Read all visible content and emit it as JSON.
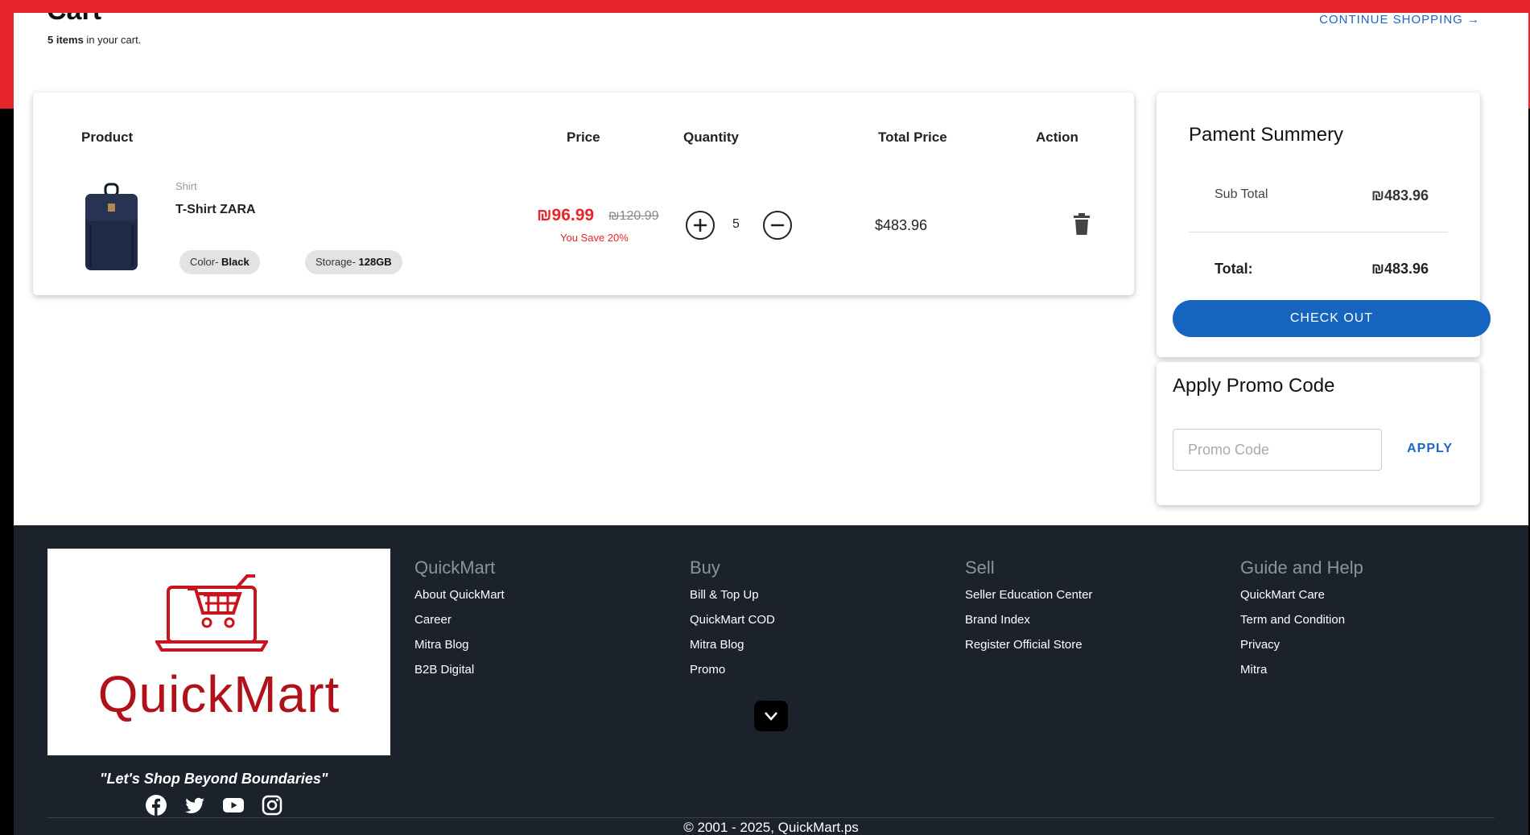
{
  "header": {
    "title": "Cart",
    "count_bold": "5 items",
    "count_rest": " in your cart.",
    "continue_label": "CONTINUE SHOPPING →"
  },
  "table": {
    "headers": [
      "Product",
      "Price",
      "Quantity",
      "Total Price",
      "Action"
    ],
    "rows": [
      {
        "category": "Shirt",
        "name": "T-Shirt ZARA",
        "color_label": "Color- ",
        "color_value": "Black",
        "storage_label": "Storage- ",
        "storage_value": "128GB",
        "price": "₪96.99",
        "old_price": "₪120.99",
        "save_text": "You Save 20%",
        "quantity": "5",
        "total": "$483.96"
      }
    ]
  },
  "summary": {
    "title": "Pament Summery",
    "subtotal_label": "Sub Total",
    "subtotal_value": "₪483.96",
    "total_label": "Total:",
    "total_value": "₪483.96",
    "checkout_label": "CHECK OUT"
  },
  "promo": {
    "title": "Apply Promo Code",
    "placeholder": "Promo Code",
    "apply_label": "APPLY"
  },
  "footer": {
    "logo_text": "QuickMart",
    "tagline": "\"Let's Shop Beyond Boundaries\"",
    "columns": [
      {
        "title": "QuickMart",
        "links": [
          "About QuickMart",
          "Career",
          "Mitra Blog",
          "B2B Digital"
        ]
      },
      {
        "title": "Buy",
        "links": [
          "Bill & Top Up",
          "QuickMart COD",
          "Mitra Blog",
          "Promo"
        ]
      },
      {
        "title": "Sell",
        "links": [
          "Seller Education Center",
          "Brand Index",
          "Register Official Store"
        ]
      },
      {
        "title": "Guide and Help",
        "links": [
          "QuickMart Care",
          "Term and Condition",
          "Privacy",
          "Mitra"
        ]
      }
    ],
    "social_icons": [
      "facebook-icon",
      "twitter-icon",
      "youtube-icon",
      "instagram-icon"
    ],
    "copyright": "© 2001 - 2025, QuickMart.ps"
  },
  "colors": {
    "frame_red": "#e8242c",
    "primary_blue": "#1565c0",
    "footer_bg": "#1b222c",
    "brand_red": "#b1121a"
  }
}
